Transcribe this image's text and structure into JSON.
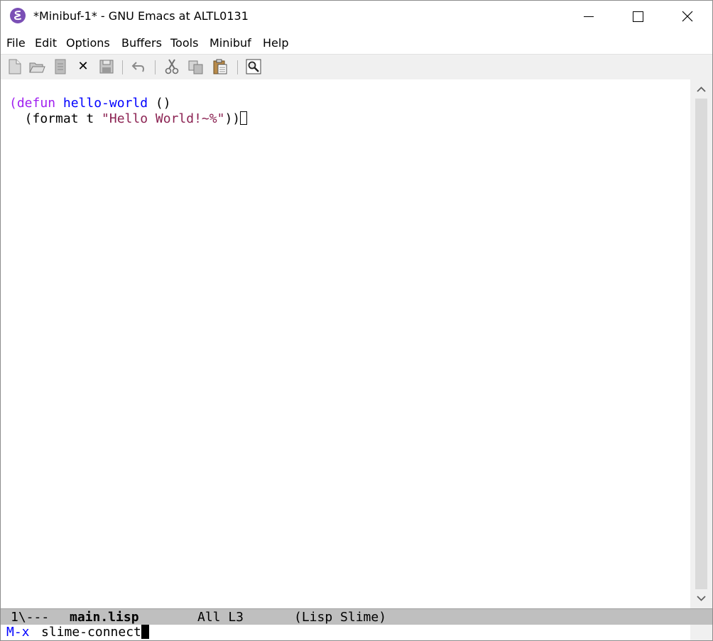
{
  "window": {
    "title": "*Minibuf-1* - GNU Emacs at ALTL0131",
    "app_icon": "emacs-icon",
    "controls": [
      "minimize-icon",
      "maximize-icon",
      "close-icon"
    ]
  },
  "menubar": {
    "items": [
      "File",
      "Edit",
      "Options",
      "Buffers",
      "Tools",
      "Minibuf",
      "Help"
    ]
  },
  "toolbar": {
    "buttons": [
      {
        "name": "new-file-icon"
      },
      {
        "name": "open-folder-icon"
      },
      {
        "name": "open-directory-icon"
      },
      {
        "name": "close-buffer-icon",
        "glyph": "✕"
      },
      {
        "name": "save-icon"
      },
      {
        "name": "undo-icon"
      },
      {
        "name": "cut-icon"
      },
      {
        "name": "copy-icon"
      },
      {
        "name": "paste-icon"
      },
      {
        "name": "search-icon"
      }
    ]
  },
  "editor": {
    "line1": {
      "open": "(",
      "keyword": "defun",
      "space1": " ",
      "name": "hello-world",
      "rest": " ()"
    },
    "line2": {
      "indent": "  (format t ",
      "string": "\"Hello World!~%\"",
      "close": "))"
    }
  },
  "modeline": {
    "status": "1\\---",
    "buffer_name": "main.lisp",
    "position": "All L3",
    "modes": "(Lisp Slime)"
  },
  "minibuffer": {
    "prompt": "M-x",
    "input": "slime-connect"
  },
  "colors": {
    "keyword": "#a020f0",
    "function_name": "#0000ff",
    "string": "#8b2252",
    "prompt": "#0000ff",
    "modeline_bg": "#bfbfbf"
  }
}
